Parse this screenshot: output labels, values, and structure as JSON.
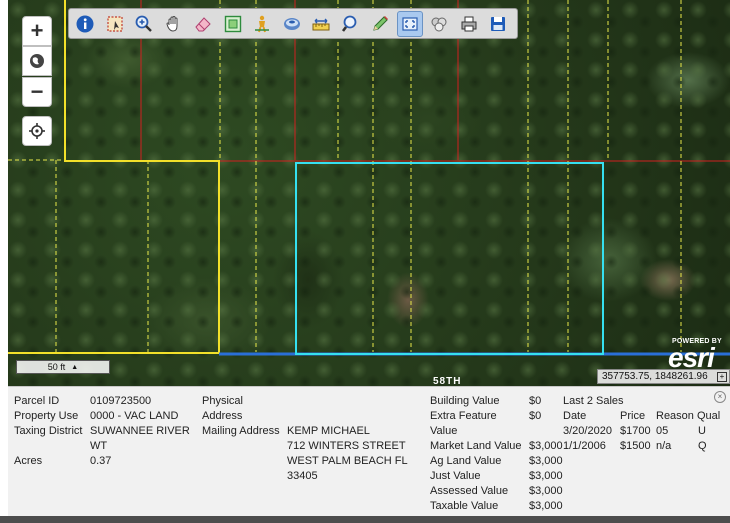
{
  "toolbar": {
    "tools": [
      {
        "name": "identify-icon",
        "color": "#1e5bb8"
      },
      {
        "name": "select-area-icon",
        "color": "#c0392b"
      },
      {
        "name": "zoom-in-tool-icon",
        "color": "#2a5db0"
      },
      {
        "name": "pan-hand-icon",
        "color": "#555555"
      },
      {
        "name": "eraser-icon",
        "color": "#d45d8a"
      },
      {
        "name": "zoom-extent-icon",
        "color": "#2e8b3d"
      },
      {
        "name": "street-view-icon",
        "color": "#e0a020"
      },
      {
        "name": "layers-icon",
        "color": "#2a5db0"
      },
      {
        "name": "measure-icon",
        "color": "#2a5db0"
      },
      {
        "name": "search-icon",
        "color": "#2a5db0"
      },
      {
        "name": "draw-pencil-icon",
        "color": "#2e8b3d"
      },
      {
        "name": "fullscreen-icon",
        "color": "#2a5db0"
      },
      {
        "name": "buffer-icon",
        "color": "#777777"
      },
      {
        "name": "print-icon",
        "color": "#333333"
      },
      {
        "name": "save-icon",
        "color": "#1e5bb8"
      }
    ]
  },
  "map": {
    "scale_label": "50 ft",
    "coords": "357753.75, 1848261.96",
    "street_label": "58TH",
    "esri_powered": "POWERED BY",
    "esri_logo": "esri",
    "controls": {
      "zoom_in": "+",
      "zoom_out": "−"
    }
  },
  "parcel": {
    "parcel_id_label": "Parcel ID",
    "parcel_id": "0109723500",
    "property_use_label": "Property Use",
    "property_use": "0000 - VAC LAND",
    "taxing_district_label": "Taxing District",
    "taxing_district_line1": "SUWANNEE RIVER",
    "taxing_district_line2": "WT",
    "acres_label": "Acres",
    "acres": "0.37",
    "physical_label_line1": "Physical",
    "physical_label_line2": "Address",
    "mailing_label": "Mailing Address",
    "mailing_line1": "KEMP MICHAEL",
    "mailing_line2": "712 WINTERS STREET",
    "mailing_line3": "WEST PALM BEACH FL",
    "mailing_line4": "33405"
  },
  "values": {
    "building_label": "Building Value",
    "building": "$0",
    "extra_feature_label_line1": "Extra Feature",
    "extra_feature_label_line2": "Value",
    "extra_feature": "$0",
    "market_land_label": "Market Land Value",
    "market_land": "$3,000",
    "ag_land_label": "Ag Land Value",
    "ag_land": "$3,000",
    "just_label": "Just Value",
    "just": "$3,000",
    "assessed_label": "Assessed Value",
    "assessed": "$3,000",
    "taxable_label": "Taxable Value",
    "taxable": "$3,000"
  },
  "sales": {
    "title": "Last 2 Sales",
    "headers": {
      "date": "Date",
      "price": "Price",
      "reason": "Reason",
      "qual": "Qual"
    },
    "rows": [
      {
        "date": "3/20/2020",
        "price": "$1700",
        "reason": "05",
        "qual": "U"
      },
      {
        "date": "1/1/2006",
        "price": "$1500",
        "reason": "n/a",
        "qual": "Q"
      }
    ]
  }
}
